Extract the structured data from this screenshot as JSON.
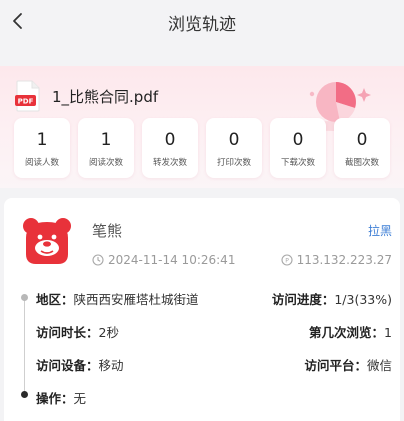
{
  "header": {
    "title": "浏览轨迹"
  },
  "file": {
    "name": "1_比熊合同.pdf",
    "icon": "pdf-file-icon",
    "icon_label": "PDF"
  },
  "stats": [
    {
      "value": "1",
      "label": "阅读人数"
    },
    {
      "value": "1",
      "label": "阅读次数"
    },
    {
      "value": "0",
      "label": "转发次数"
    },
    {
      "value": "0",
      "label": "打印次数"
    },
    {
      "value": "0",
      "label": "下载次数"
    },
    {
      "value": "0",
      "label": "截图次数"
    }
  ],
  "record": {
    "name": "笔熊",
    "action": "拉黑",
    "time": "2024-11-14 10:26:41",
    "ip": "113.132.223.27",
    "region_label": "地区：",
    "region_value": "陕西西安雁塔杜城街道",
    "progress_label": "访问进度：",
    "progress_value": "1/3(33%)",
    "duration_label": "访问时长：",
    "duration_value": "2秒",
    "visit_no_label": "第几次浏览：",
    "visit_no_value": "1",
    "device_label": "访问设备：",
    "device_value": "移动",
    "platform_label": "访问平台：",
    "platform_value": "微信",
    "operation_label": "操作：",
    "operation_value": "无"
  },
  "colors": {
    "accent_red": "#e8323a",
    "link_blue": "#3f7fd6",
    "card_pink": "#fde8ec"
  }
}
